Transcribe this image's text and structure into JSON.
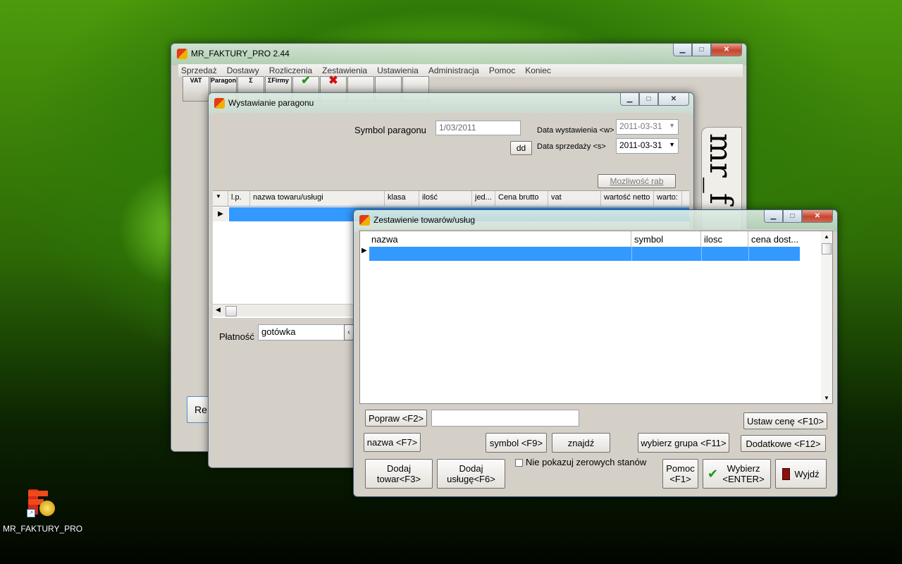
{
  "desktop": {
    "icon_label": "MR_FAKTURY_PRO"
  },
  "main_window": {
    "title": "MR_FAKTURY_PRO 2.44",
    "menu": [
      "Sprzedaż",
      "Dostawy",
      "Rozliczenia",
      "Zestawienia",
      "Ustawienia",
      "Administracja",
      "Pomoc",
      "Koniec"
    ],
    "toolbar": [
      "VAT",
      "Paragon",
      "Σ",
      "ΣFirmy"
    ],
    "partial_button": "Re",
    "side_banner": "mr_f"
  },
  "receipt_window": {
    "title": "Wystawianie paragonu",
    "symbol_label": "Symbol paragonu",
    "symbol_value": "1/03/2011",
    "dd_button": "dd",
    "issue_date_label": "Data wystawienia <w>",
    "issue_date_value": "2011-03-31",
    "sale_date_label": "Data sprzedaży <s>",
    "sale_date_value": "2011-03-31",
    "discount_button": "Mozliwość rab",
    "columns": [
      "l.p.",
      "nazwa towaru/usługi",
      "klasa",
      "ilość",
      "jed...",
      "Cena brutto",
      "vat",
      "wartość netto",
      "warto:"
    ],
    "payment_label": "Płatność",
    "payment_value": "gotówka"
  },
  "goods_window": {
    "title": "Zestawienie towarów/usług",
    "columns": [
      "nazwa",
      "symbol",
      "ilosc",
      "cena dost..."
    ],
    "buttons": {
      "edit": "Popraw <F2>",
      "set_price": "Ustaw cenę <F10>",
      "name": "nazwa <F7>",
      "symbol": "symbol <F9>",
      "find": "znajdź",
      "choose_group": "wybierz grupa <F11>",
      "additional": "Dodatkowe <F12>",
      "add_goods": "Dodaj towar<F3>",
      "add_service": "Dodaj usługę<F6>",
      "help": "Pomoc <F1>",
      "select": "Wybierz <ENTER>",
      "exit": "Wyjdź"
    },
    "hide_zero_label": "Nie pokazuj zerowych stanów",
    "search_value": ""
  }
}
